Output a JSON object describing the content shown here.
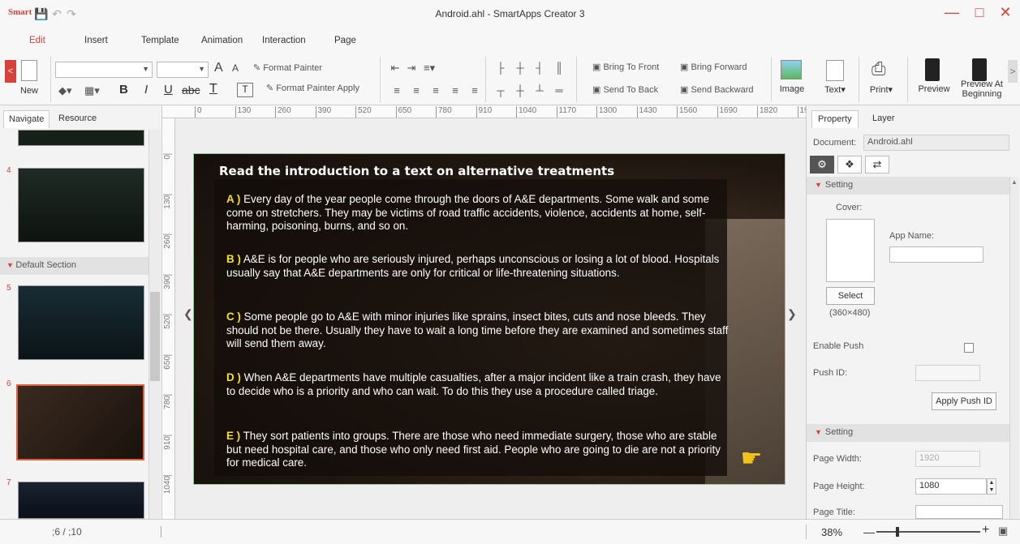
{
  "window": {
    "logo": "Smart",
    "title": "Android.ahl - SmartApps Creator 3",
    "minimize": "—",
    "restore": "□",
    "close": "✕"
  },
  "menu": [
    "Edit",
    "Insert",
    "Template",
    "Animation",
    "Interaction",
    "Page"
  ],
  "ribbon": {
    "new_label": "New",
    "format_painter": "Format Painter",
    "format_painter_apply": "Format Painter Apply",
    "bring_to_front": "Bring To Front",
    "bring_forward": "Bring Forward",
    "send_to_back": "Send To Back",
    "send_backward": "Send Backward",
    "image": "Image",
    "text": "Text▾",
    "print": "Print▾",
    "preview": "Preview",
    "preview_at_line1": "Preview At",
    "preview_at_line2": "Beginning",
    "bold": "B",
    "italic": "I",
    "underline": "U",
    "strike": "abc",
    "font_color": "T",
    "grow": "A",
    "shrink": "A"
  },
  "left_panel": {
    "tabs": [
      "Navigate",
      "Resource"
    ],
    "section": "Default Section",
    "thumb_numbers": [
      "4",
      "5",
      "6",
      "7"
    ]
  },
  "ruler": {
    "h": [
      "0",
      "130",
      "260",
      "390",
      "520",
      "650",
      "780",
      "910",
      "1040",
      "1170",
      "1300",
      "1430",
      "1560",
      "1690",
      "1820",
      "19"
    ],
    "v": [
      "0",
      "130",
      "260",
      "390",
      "520",
      "650",
      "780",
      "910",
      "1040"
    ]
  },
  "slide": {
    "title": "Read the introduction to a text on alternative treatments",
    "paragraphs": [
      {
        "letter": "A )",
        "text": " Every day of the year people come through the doors of A&E departments. Some walk and some come on stretchers. They may be victims of road traffic accidents, violence, accidents at home, self-harming, poisoning, burns, and so on."
      },
      {
        "letter": "B )",
        "text": " A&E is for people who are seriously injured, perhaps unconscious or losing a lot of blood. Hospitals usually say that A&E departments are only for critical or life-threatening situations."
      },
      {
        "letter": "C )",
        "text": " Some people go to A&E with minor injuries like sprains, insect bites, cuts and nose bleeds. They should not be there. Usually they have to wait a long time before they are examined and sometimes staff will send them away."
      },
      {
        "letter": "D )",
        "text": " When A&E departments have multiple casualties, after a major incident like a train crash, they have to decide who is a priority and who can wait. To do this they use a procedure called triage."
      },
      {
        "letter": "E )",
        "text": " They sort patients into groups. There are those who need immediate surgery, those who are stable but need hospital care, and those who only need first aid. People who are going to die are not a priority for medical care."
      }
    ]
  },
  "right_panel": {
    "tabs": [
      "Property",
      "Layer"
    ],
    "document_label": "Document:",
    "document_value": "Android.ahl",
    "setting1": "Setting",
    "cover_label": "Cover:",
    "app_name_label": "App Name:",
    "select_button": "Select",
    "cover_size": "(360×480)",
    "enable_push": "Enable Push",
    "push_id": "Push ID:",
    "apply_push_id": "Apply Push ID",
    "setting2": "Setting",
    "page_width_label": "Page Width:",
    "page_width_value": "1920",
    "page_height_label": "Page Height:",
    "page_height_value": "1080",
    "page_title_label": "Page Title:"
  },
  "status": {
    "page_counter": ";6  /  ;10",
    "zoom": "38%",
    "zoom_fraction": 0.38
  },
  "colors": {
    "accent": "#d8403a",
    "highlight_letter": "#f3e21c"
  }
}
